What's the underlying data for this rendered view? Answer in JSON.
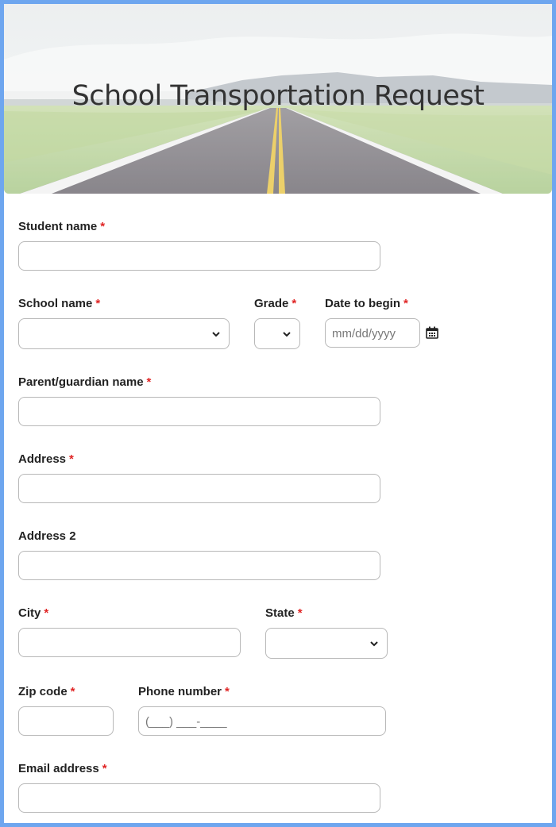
{
  "header": {
    "title": "School Transportation Request"
  },
  "form": {
    "student_name": {
      "label": "Student name",
      "required": "*"
    },
    "school_name": {
      "label": "School name",
      "required": "*"
    },
    "grade": {
      "label": "Grade",
      "required": "*"
    },
    "date_to_begin": {
      "label": "Date to begin",
      "required": "*",
      "placeholder": "mm/dd/yyyy",
      "icon": "calendar-icon"
    },
    "parent_name": {
      "label": "Parent/guardian name",
      "required": "*"
    },
    "address": {
      "label": "Address",
      "required": "*"
    },
    "address2": {
      "label": "Address 2"
    },
    "city": {
      "label": "City",
      "required": "*"
    },
    "state": {
      "label": "State",
      "required": "*"
    },
    "zip": {
      "label": "Zip code",
      "required": "*"
    },
    "phone": {
      "label": "Phone number",
      "required": "*",
      "placeholder": "(___) ___-____"
    },
    "email": {
      "label": "Email address",
      "required": "*"
    }
  },
  "colors": {
    "frame": "#6ea6ef",
    "required": "#e02424",
    "border": "#b8b8b8"
  }
}
